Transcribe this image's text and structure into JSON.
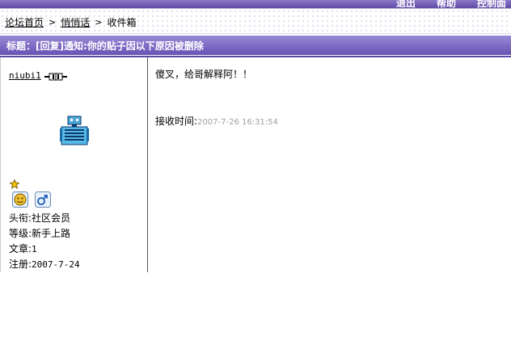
{
  "header": {
    "nav": [
      "退出",
      "帮助",
      "控制面"
    ]
  },
  "breadcrumb": {
    "home": "论坛首页",
    "section": "悄悄话",
    "current": "收件箱",
    "separator": ">"
  },
  "message": {
    "title": "标题：[回复]通知:你的贴子因以下原因被删除",
    "body": "傻叉，给哥解释阿！！",
    "received_label": "接收时间:",
    "received_time": "2007-7-26 16:31:54"
  },
  "author": {
    "username": "niubi1",
    "title_label": "头衔:",
    "title_value": "社区会员",
    "level_label": "等级:",
    "level_value": "新手上路",
    "posts_label": "文章:",
    "posts_value": "1",
    "registered_label": "注册:",
    "registered_value": "2007-7-24"
  },
  "icons": {
    "plug": "plug-icon",
    "avatar": "robot-avatar-icon",
    "star": "star-icon",
    "medal": "medal-icon",
    "gender": "male-icon"
  }
}
